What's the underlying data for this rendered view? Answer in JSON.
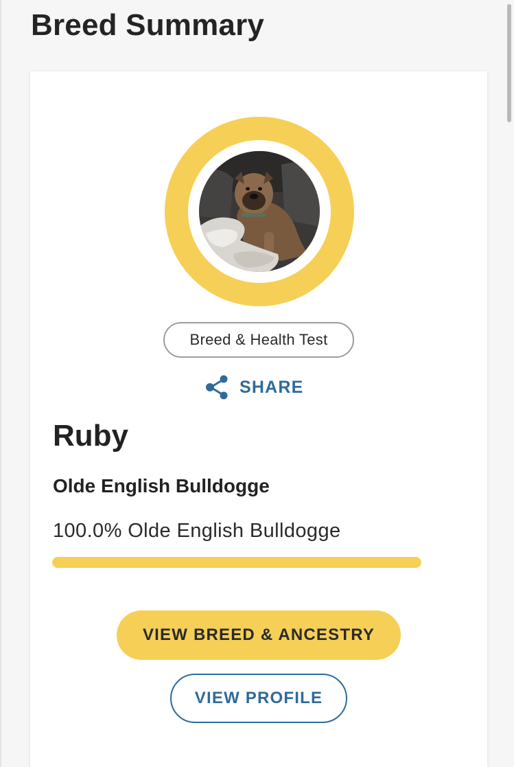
{
  "page": {
    "title": "Breed Summary"
  },
  "profile": {
    "name": "Ruby",
    "photo_icon": "dog-photo",
    "ring_color": "#f6cf56",
    "test_type": "Breed & Health Test"
  },
  "share": {
    "label": "SHARE",
    "icon": "share-icon",
    "color": "#2d6b9a"
  },
  "breed": {
    "heading": "Olde English Bulldogge",
    "entries": [
      {
        "label": "100.0% Olde English Bulldogge",
        "percent": 100.0,
        "color": "#f6cf56"
      }
    ]
  },
  "actions": {
    "view_breed_ancestry": "VIEW BREED & ANCESTRY",
    "view_profile": "VIEW PROFILE"
  },
  "colors": {
    "accent": "#f6cf56",
    "link": "#2d6b9a",
    "background": "#f6f6f6"
  }
}
